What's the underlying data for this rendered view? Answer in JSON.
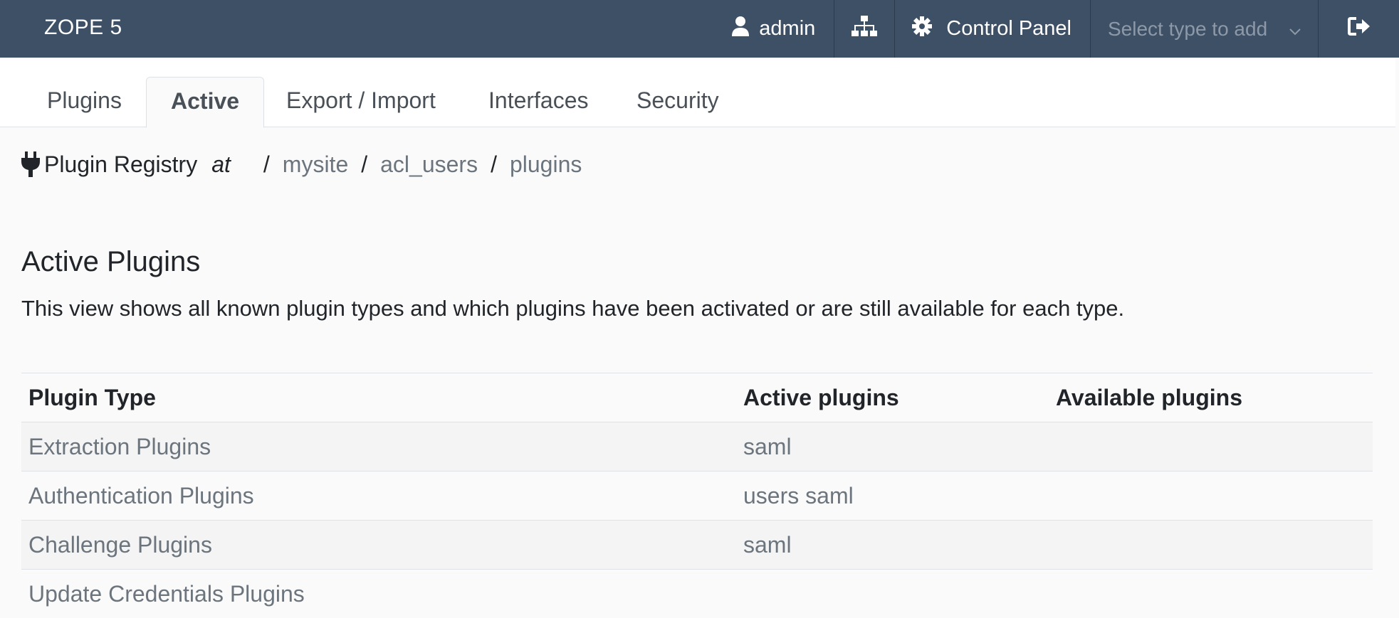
{
  "navbar": {
    "brand": "ZOPE 5",
    "user": "admin",
    "control_panel": "Control Panel",
    "select_placeholder": "Select type to add",
    "icons": [
      "user-icon",
      "sitemap-icon",
      "gear-icon",
      "chevron-down-icon",
      "logout-icon"
    ]
  },
  "tabs": [
    {
      "label": "Plugins",
      "active": false
    },
    {
      "label": "Active",
      "active": true
    },
    {
      "label": "Export / Import",
      "active": false
    },
    {
      "label": "Interfaces",
      "active": false
    },
    {
      "label": "Security",
      "active": false
    }
  ],
  "breadcrumb": {
    "title": "Plugin Registry",
    "at": "at",
    "separator": "/",
    "path": [
      "mysite",
      "acl_users",
      "plugins"
    ]
  },
  "main": {
    "heading": "Active Plugins",
    "description": "This view shows all known plugin types and which plugins have been activated or are still available for each type."
  },
  "table": {
    "headers": [
      "Plugin Type",
      "Active plugins",
      "Available plugins"
    ],
    "rows": [
      {
        "type": "Extraction Plugins",
        "active": "saml",
        "available": ""
      },
      {
        "type": "Authentication Plugins",
        "active": "users saml",
        "available": ""
      },
      {
        "type": "Challenge Plugins",
        "active": "saml",
        "available": ""
      },
      {
        "type": "Update Credentials Plugins",
        "active": "",
        "available": ""
      }
    ]
  }
}
